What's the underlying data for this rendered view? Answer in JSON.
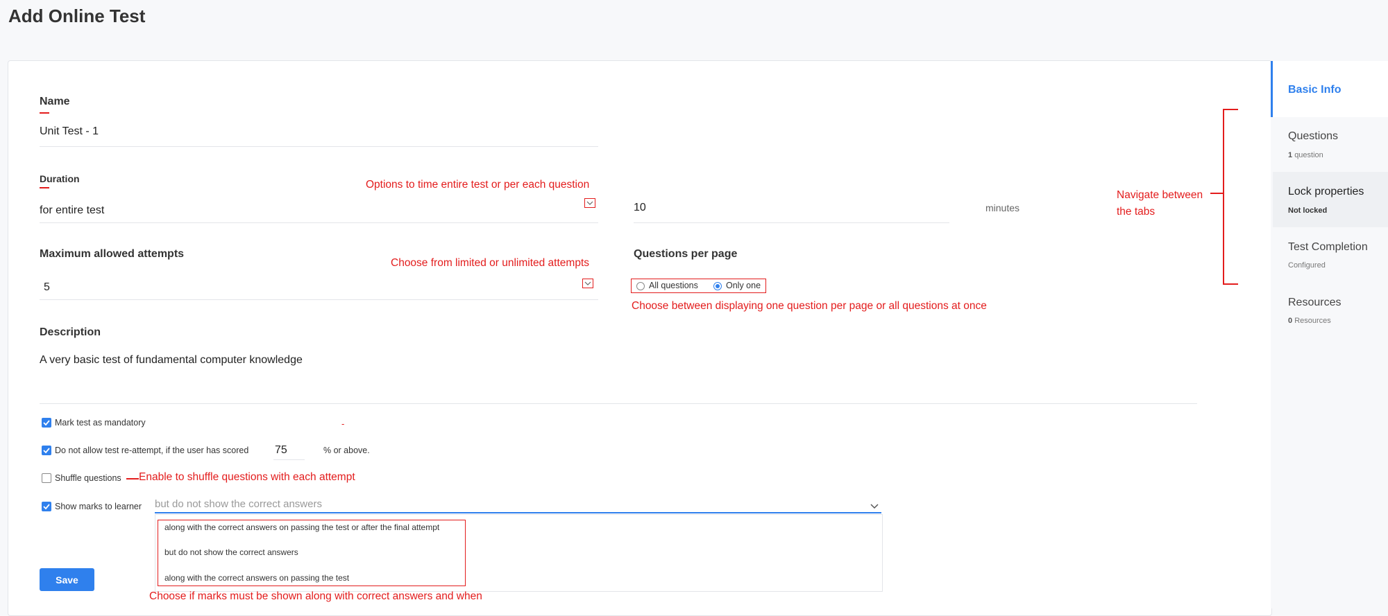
{
  "page": {
    "title": "Add Online Test"
  },
  "form": {
    "name": {
      "label": "Name",
      "value": "Unit Test - 1"
    },
    "duration": {
      "label": "Duration",
      "value": "for entire test",
      "amount": "10",
      "unit": "minutes"
    },
    "attempts": {
      "label": "Maximum allowed attempts",
      "value": "5"
    },
    "questions_per_page": {
      "label": "Questions per page",
      "options": [
        "All questions",
        "Only one"
      ],
      "selected": "Only one"
    },
    "description": {
      "label": "Description",
      "value": "A very basic test of fundamental computer knowledge"
    },
    "mandatory": {
      "label": "Mark test as mandatory",
      "checked": true
    },
    "reattempt": {
      "label": "Do not allow test re-attempt, if the user has scored",
      "value": "75",
      "suffix": "% or above.",
      "checked": true
    },
    "shuffle": {
      "label": "Shuffle questions",
      "checked": false
    },
    "show_marks": {
      "label": "Show marks to learner",
      "checked": true,
      "selected": "but do not show the correct answers",
      "options": [
        "along with the correct answers on passing the test or after the final attempt",
        "but do not show the correct answers",
        "along with the correct answers on passing the test"
      ]
    },
    "save_label": "Save"
  },
  "annotations": {
    "duration": "Options to time entire test or per each question",
    "attempts": "Choose from limited or unlimited attempts",
    "qpp": "Choose between displaying one question per page or all questions at once",
    "shuffle": "Enable to shuffle questions with each attempt",
    "marks": "Choose if marks must be shown along with correct answers and when",
    "tabs": "Navigate between the tabs",
    "stray_dash": "-"
  },
  "nav": {
    "items": [
      {
        "label": "Basic Info",
        "sub": ""
      },
      {
        "label": "Questions",
        "sub_count": "1",
        "sub": "question"
      },
      {
        "label": "Lock properties",
        "sub": "Not locked"
      },
      {
        "label": "Test Completion",
        "sub": "Configured"
      },
      {
        "label": "Resources",
        "sub_count": "0",
        "sub": "Resources"
      }
    ]
  },
  "colors": {
    "accent": "#2f80ed",
    "annotation": "#e31c1c"
  },
  "icons": [
    "chevron-down-icon",
    "checkmark-icon",
    "radio-icon"
  ]
}
